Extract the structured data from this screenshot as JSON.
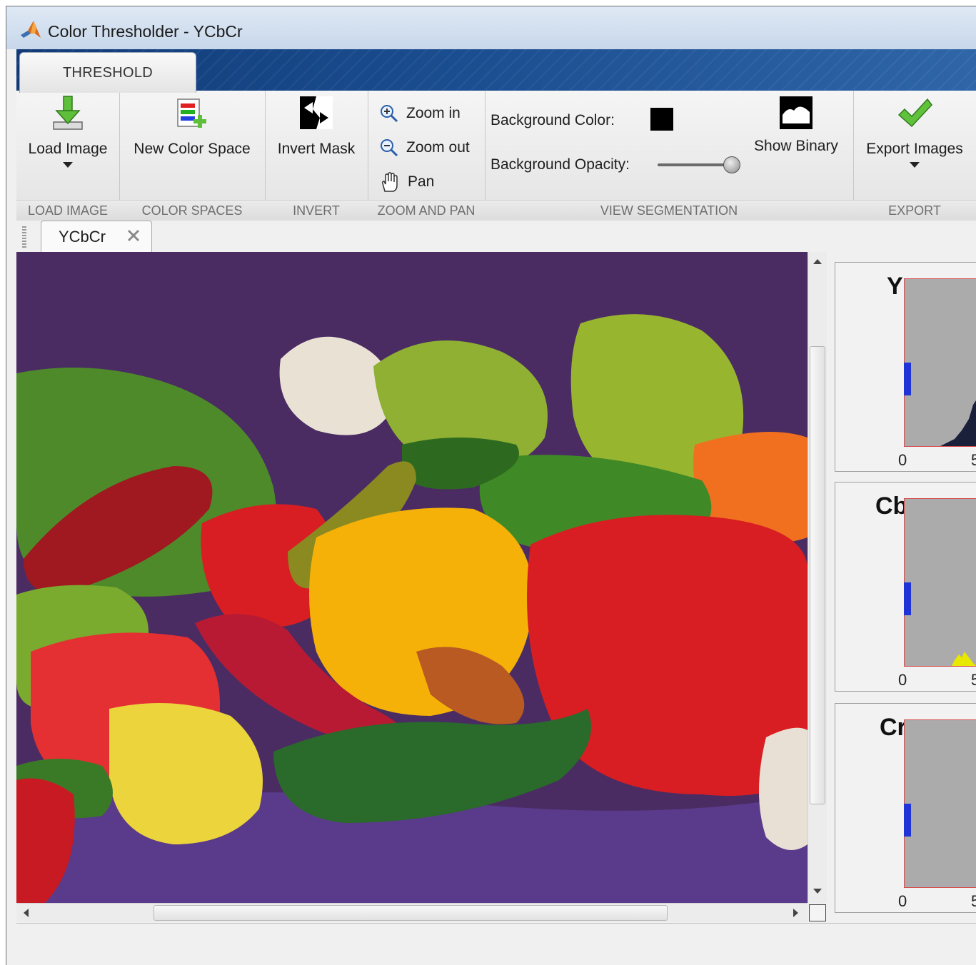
{
  "window": {
    "title": "Color Thresholder - YCbCr"
  },
  "ribbon": {
    "tab": "THRESHOLD",
    "load_image": {
      "label": "Load Image",
      "section": "LOAD IMAGE"
    },
    "color_spaces": {
      "new_label": "New Color Space",
      "section": "COLOR SPACES"
    },
    "invert": {
      "label": "Invert Mask",
      "section": "INVERT"
    },
    "zoom_pan": {
      "zoom_in": "Zoom in",
      "zoom_out": "Zoom out",
      "pan": "Pan",
      "section": "ZOOM AND PAN"
    },
    "view_segmentation": {
      "bg_color_label": "Background Color:",
      "bg_color_value": "#000000",
      "bg_opacity_label": "Background Opacity:",
      "bg_opacity_value": 1.0,
      "show_binary": "Show Binary",
      "section": "VIEW SEGMENTATION"
    },
    "export": {
      "label": "Export Images",
      "section": "EXPORT"
    }
  },
  "document_tab": {
    "name": "YCbCr"
  },
  "histograms": [
    {
      "channel": "Y",
      "tick_min": "0",
      "tick_max": "5",
      "fill": "#1a1f3a"
    },
    {
      "channel": "Cb",
      "tick_min": "0",
      "tick_max": "5",
      "fill": "#e8e800"
    },
    {
      "channel": "Cr",
      "tick_min": "0",
      "tick_max": "5",
      "fill": "#d12b2b"
    }
  ],
  "colors": {
    "accent_blue": "#1a4d8f",
    "handle_blue": "#1f33d6",
    "hist_bg": "#ababab",
    "hist_border": "#d64a4a"
  }
}
